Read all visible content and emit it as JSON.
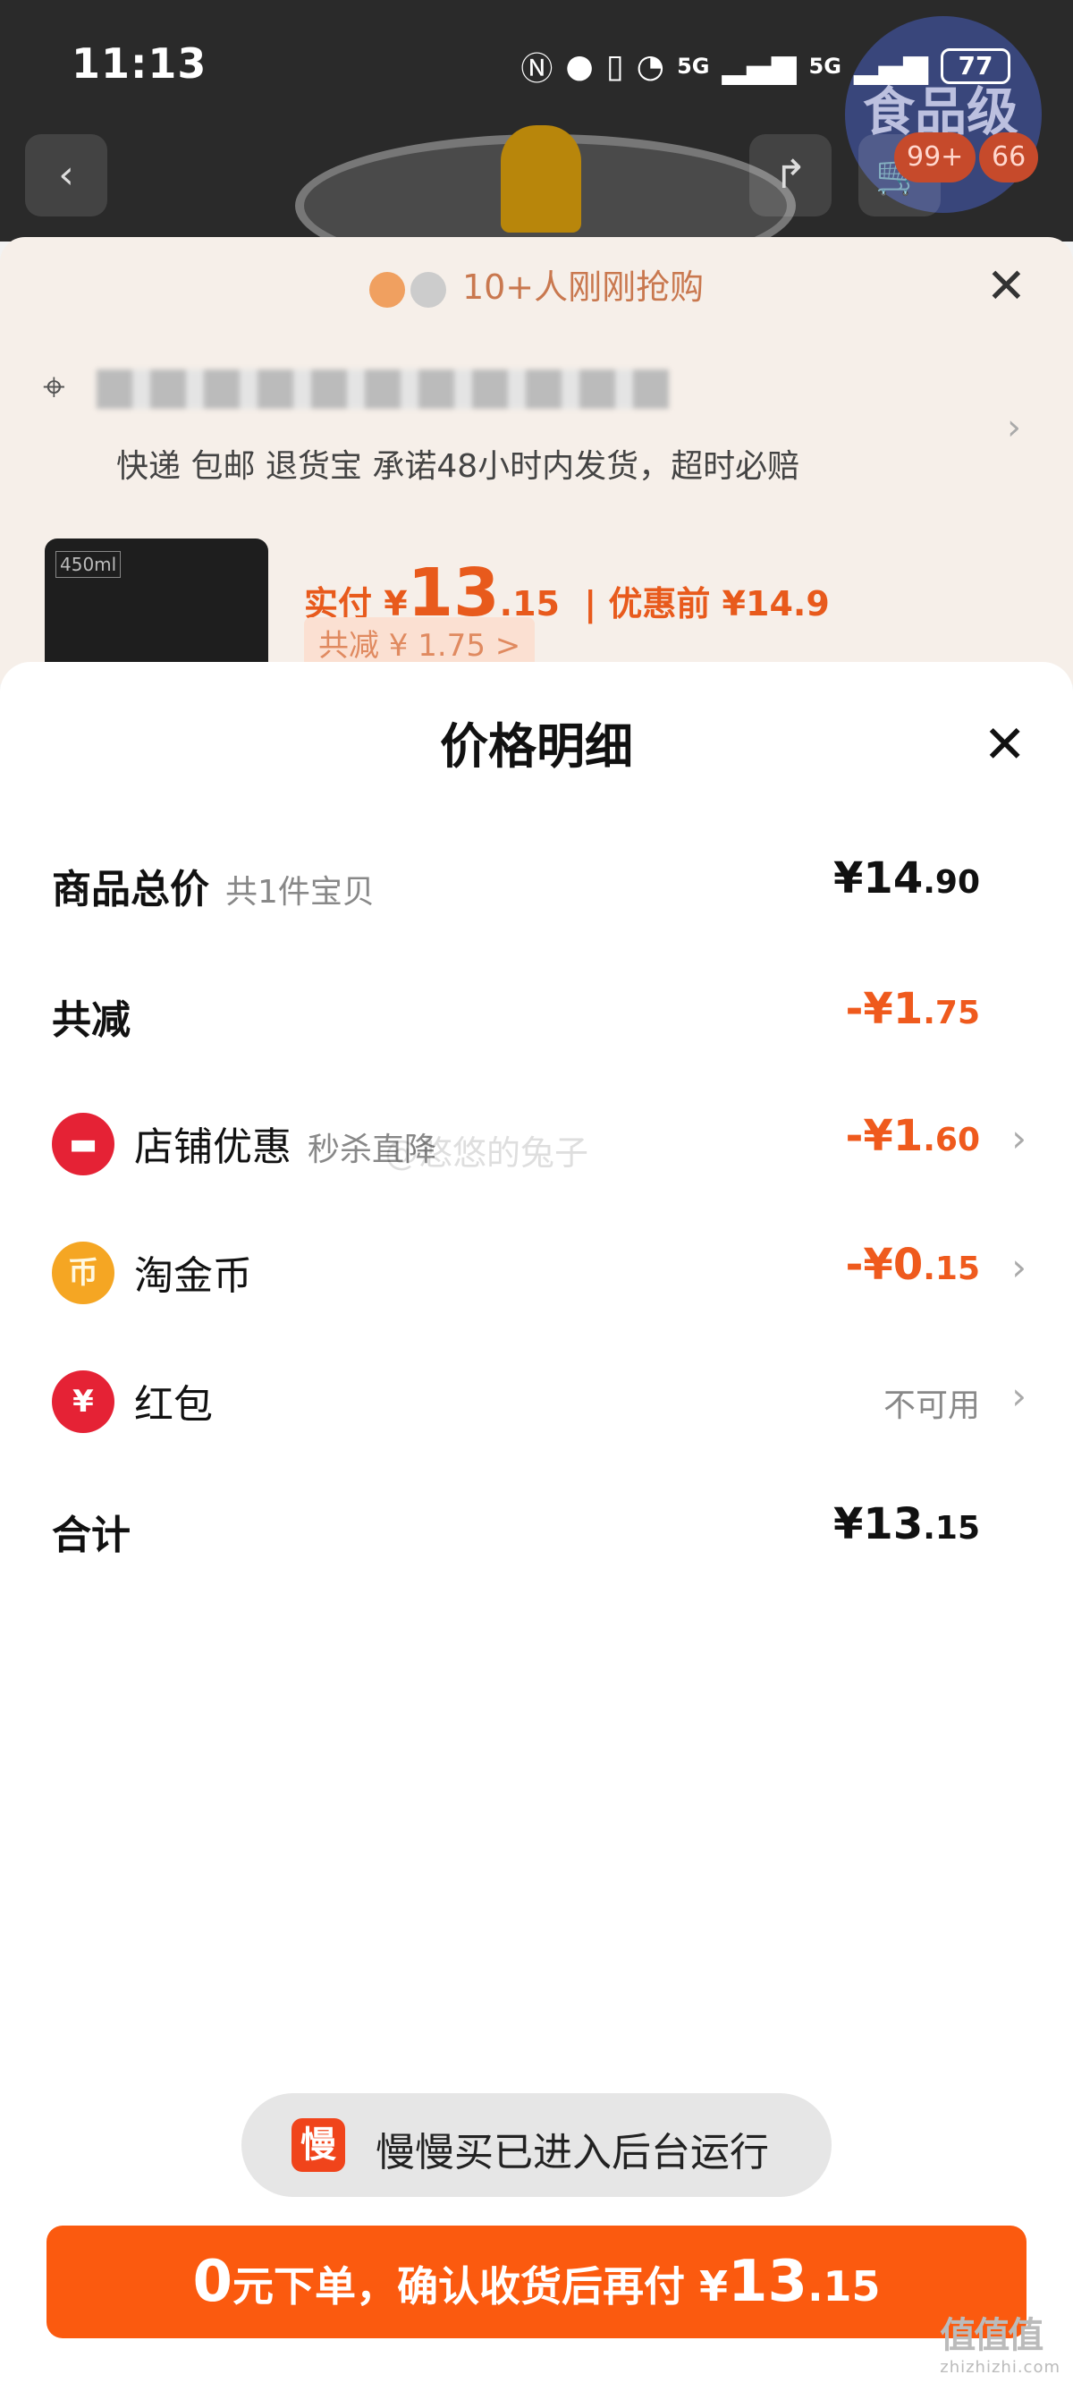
{
  "status_bar": {
    "time": "11:13",
    "battery": "77",
    "network1": "5G",
    "network2": "5G"
  },
  "background": {
    "badge_text": "食品级",
    "cart_badge": "99+",
    "more_badge": "66",
    "buyers_text": "10+人刚刚抢购",
    "shipping_text": "快递 包邮 退货宝 承诺48小时内发货，超时必赔",
    "thumb_label": "450ml",
    "real_pay_prefix": "实付 ¥",
    "real_pay_int": "13",
    "real_pay_dec": ".15",
    "pre_discount": "| 优惠前 ¥14.9",
    "total_discount": "共减 ¥ 1.75 >"
  },
  "sheet": {
    "title": "价格明细",
    "rows": [
      {
        "label": "商品总价",
        "sub": "共1件宝贝",
        "amount_int": "¥14",
        "amount_dec": ".90"
      },
      {
        "label": "共减",
        "amount_int": "-¥1",
        "amount_dec": ".75"
      },
      {
        "label": "店铺优惠",
        "sub": "秒杀直降",
        "amount_int": "-¥1",
        "amount_dec": ".60"
      },
      {
        "label": "淘金币",
        "amount_int": "-¥0",
        "amount_dec": ".15"
      },
      {
        "label": "红包",
        "amount_text": "不可用"
      },
      {
        "label": "合计",
        "amount_int": "¥13",
        "amount_dec": ".15"
      }
    ]
  },
  "watermark": "@悠悠的兔子",
  "toast": {
    "icon_text": "慢",
    "text": "慢慢买已进入后台运行"
  },
  "cta": {
    "pre": "0",
    "mid": "元下单，确认收货后再付 ¥",
    "int": "13",
    "dec": ".15"
  },
  "corner_logo": {
    "text": "值值值",
    "sub": "zhizhizhi.com"
  },
  "colors": {
    "accent": "#fb5a0f",
    "discount": "#ef5a1d",
    "shop_icon": "#e52235",
    "coin_icon": "#f5a623"
  }
}
